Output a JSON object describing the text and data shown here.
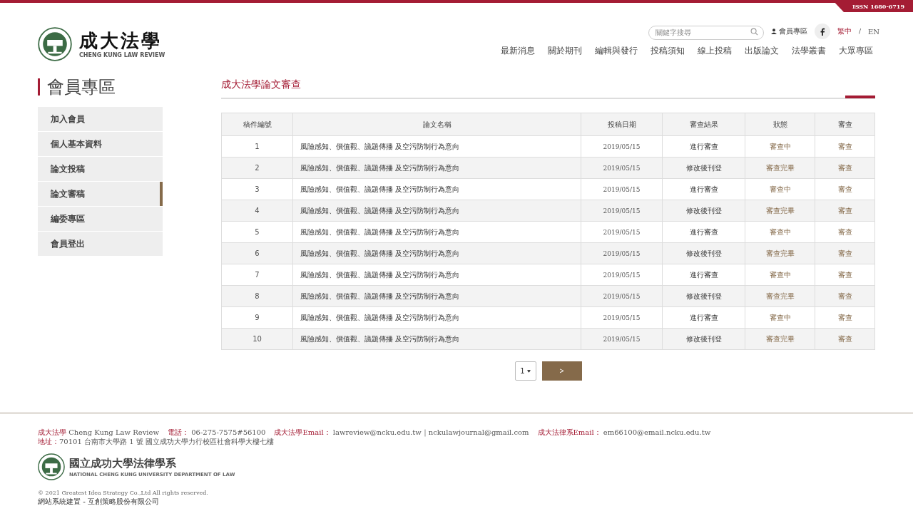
{
  "issn": "ISSN 1680-6719",
  "logo": {
    "title": "成大法學",
    "subtitle": "CHENG KUNG LAW REVIEW"
  },
  "search": {
    "placeholder": "關鍵字搜尋"
  },
  "member_link": "會員專區",
  "languages": [
    {
      "label": "繁中",
      "selected": true
    },
    {
      "label": "EN",
      "selected": false
    }
  ],
  "language_separator": "/",
  "nav": [
    "最新消息",
    "關於期刊",
    "編輯與發行",
    "投稿須知",
    "線上投稿",
    "出版論文",
    "法學叢書",
    "大眾專區"
  ],
  "sidebar": {
    "title": "會員專區",
    "items": [
      {
        "label": "加入會員",
        "selected": false
      },
      {
        "label": "個人基本資料",
        "selected": false
      },
      {
        "label": "論文投稿",
        "selected": false
      },
      {
        "label": "論文審稿",
        "selected": true
      },
      {
        "label": "編委專區",
        "selected": false
      },
      {
        "label": "會員登出",
        "selected": false
      }
    ]
  },
  "section_title": "成大法學論文審查",
  "table": {
    "columns": [
      "稿件編號",
      "論文名稱",
      "投稿日期",
      "審查結果",
      "狀態",
      "審查"
    ],
    "rows": [
      [
        "1",
        "風險感知、價值觀、議題傳播 及空污防制行為意向",
        "2019/05/15",
        "進行審查",
        "審查中",
        "審查"
      ],
      [
        "2",
        "風險感知、價值觀、議題傳播 及空污防制行為意向",
        "2019/05/15",
        "修改後刊登",
        "審查完畢",
        "審查"
      ],
      [
        "3",
        "風險感知、價值觀、議題傳播 及空污防制行為意向",
        "2019/05/15",
        "進行審查",
        "審查中",
        "審查"
      ],
      [
        "4",
        "風險感知、價值觀、議題傳播 及空污防制行為意向",
        "2019/05/15",
        "修改後刊登",
        "審查完畢",
        "審查"
      ],
      [
        "5",
        "風險感知、價值觀、議題傳播 及空污防制行為意向",
        "2019/05/15",
        "進行審查",
        "審查中",
        "審查"
      ],
      [
        "6",
        "風險感知、價值觀、議題傳播 及空污防制行為意向",
        "2019/05/15",
        "修改後刊登",
        "審查完畢",
        "審查"
      ],
      [
        "7",
        "風險感知、價值觀、議題傳播 及空污防制行為意向",
        "2019/05/15",
        "進行審查",
        "審查中",
        "審查"
      ],
      [
        "8",
        "風險感知、價值觀、議題傳播 及空污防制行為意向",
        "2019/05/15",
        "修改後刊登",
        "審查完畢",
        "審查"
      ],
      [
        "9",
        "風險感知、價值觀、議題傳播 及空污防制行為意向",
        "2019/05/15",
        "進行審查",
        "審查中",
        "審查"
      ],
      [
        "10",
        "風險感知、價值觀、議題傳播 及空污防制行為意向",
        "2019/05/15",
        "修改後刊登",
        "審查完畢",
        "審查"
      ]
    ]
  },
  "pagination": {
    "page": "1",
    "next": ">"
  },
  "footer": {
    "contacts": [
      {
        "label": "成大法學",
        "value": "Cheng Kung Law Review"
      },
      {
        "label": "電話：",
        "value": "06-275-7575#56100"
      },
      {
        "label": "成大法學Email：",
        "value": "lawreview@ncku.edu.tw｜nckulawjournal@gmail.com"
      },
      {
        "label": "成大法律系Email：",
        "value": "em66100@email.ncku.edu.tw"
      }
    ],
    "address": {
      "label": "地址：",
      "value": "70101 台南市大學路 1 號 國立成功大學力行校區社會科學大樓七樓"
    },
    "logo": {
      "title": "國立成功大學法律學系",
      "subtitle": "NATIONAL CHENG KUNG UNIVERSITY DEPARTMENT OF LAW"
    },
    "copyright": "© 2021 Greatest Idea Strategy Co.,Ltd All rights reserved.",
    "credit": "網站系統建置 - 互創策略股份有限公司"
  }
}
